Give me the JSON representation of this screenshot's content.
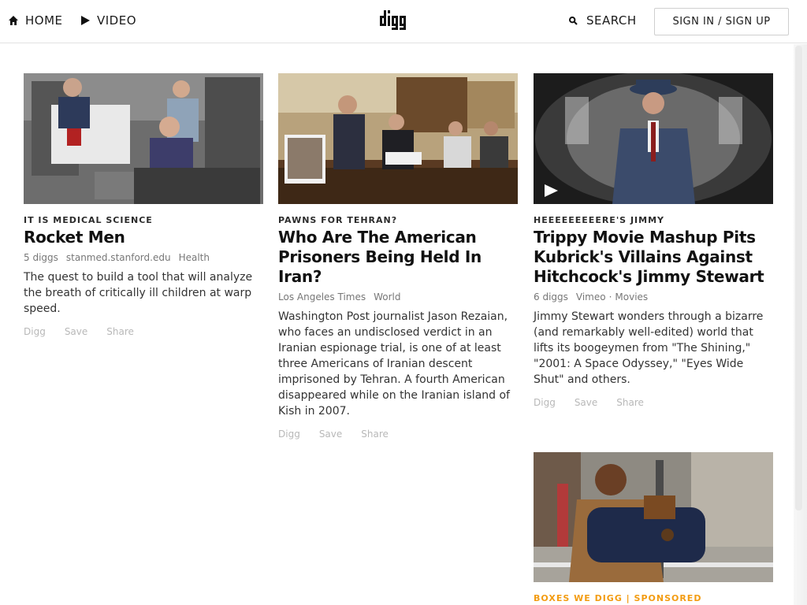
{
  "header": {
    "home_label": "HOME",
    "video_label": "VIDEO",
    "logo_text": "digg",
    "search_label": "SEARCH",
    "signin_label": "SIGN IN / SIGN UP"
  },
  "icons": {
    "home": "home-icon",
    "video": "play-icon",
    "search": "search-icon",
    "video_badge": "play-icon"
  },
  "colors": {
    "sponsored": "#f39c12",
    "meta": "#777777",
    "actions": "#b8b8b8"
  },
  "stories": [
    {
      "kicker": "IT IS MEDICAL SCIENCE",
      "title": "Rocket Men",
      "diggs": "5 diggs",
      "source": "stanmed.stanford.edu",
      "topic": "Health",
      "description": "The quest to build a tool that will analyze the breath of critically ill children at warp speed.",
      "actions": [
        "Digg",
        "Save",
        "Share"
      ]
    },
    {
      "kicker": "PAWNS FOR TEHRAN?",
      "title": "Who Are The American Prisoners Being Held In Iran?",
      "diggs": "",
      "source": "Los Angeles Times",
      "topic": "World",
      "description": "Washington Post journalist Jason Rezaian, who faces an undisclosed verdict in an Iranian espionage trial, is one of at least three Americans of Iranian descent imprisoned by Tehran. A fourth American disappeared while on the Iranian island of Kish in 2007.",
      "actions": [
        "Digg",
        "Save",
        "Share"
      ]
    },
    {
      "kicker": "HEEEEEEEEERE'S JIMMY",
      "title": "Trippy Movie Mashup Pits Kubrick's Villains Against Hitchcock's Jimmy Stewart",
      "diggs": "6 diggs",
      "source": "Vimeo",
      "separator": "·",
      "topic": "Movies",
      "description": "Jimmy Stewart wonders through a bizarre (and remarkably well-edited) world that lifts its boogeymen from \"The Shining,\" \"2001: A Space Odyssey,\" \"Eyes Wide Shut\" and others.",
      "actions": [
        "Digg",
        "Save",
        "Share"
      ]
    },
    {
      "kicker": "BOXES WE DIGG | SPONSORED"
    }
  ]
}
